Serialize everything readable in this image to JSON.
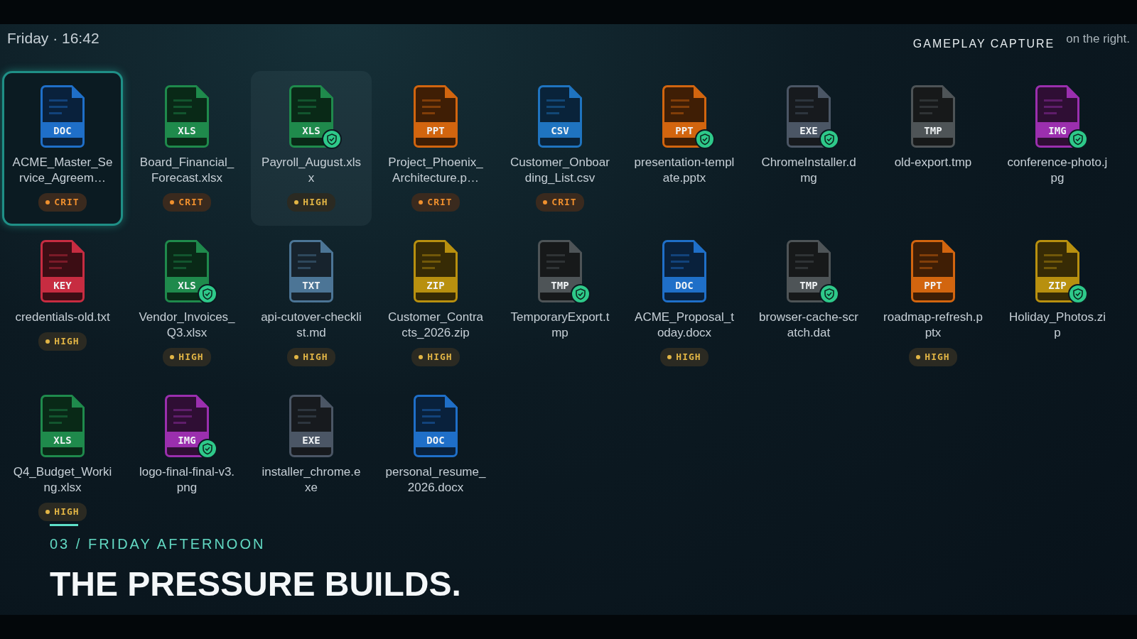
{
  "status": {
    "time": "Friday · 16:42",
    "label": "GAMEPLAY CAPTURE",
    "overlay_text": "on the right."
  },
  "files": [
    {
      "name": "ACME_Master_Service_Agreem…",
      "ext": "DOC",
      "color": "#1f6fc8",
      "shield": false,
      "badge": {
        "kind": "crit",
        "label": "CRIT"
      },
      "selected": true,
      "hovered": false
    },
    {
      "name": "Board_Financial_Forecast.xlsx",
      "ext": "XLS",
      "color": "#1f8a4c",
      "shield": false,
      "badge": {
        "kind": "crit",
        "label": "CRIT"
      },
      "selected": false,
      "hovered": false
    },
    {
      "name": "Payroll_August.xlsx",
      "ext": "XLS",
      "color": "#1f8a4c",
      "shield": true,
      "badge": {
        "kind": "high",
        "label": "HIGH"
      },
      "selected": false,
      "hovered": true
    },
    {
      "name": "Project_Phoenix_Architecture.p…",
      "ext": "PPT",
      "color": "#d2650f",
      "shield": false,
      "badge": {
        "kind": "crit",
        "label": "CRIT"
      },
      "selected": false,
      "hovered": false
    },
    {
      "name": "Customer_Onboarding_List.csv",
      "ext": "CSV",
      "color": "#1f74c0",
      "shield": false,
      "badge": {
        "kind": "crit",
        "label": "CRIT"
      },
      "selected": false,
      "hovered": false
    },
    {
      "name": "presentation-template.pptx",
      "ext": "PPT",
      "color": "#d2650f",
      "shield": true,
      "selected": false,
      "hovered": false
    },
    {
      "name": "ChromeInstaller.dmg",
      "ext": "EXE",
      "color": "#4b5665",
      "shield": true,
      "selected": false,
      "hovered": false
    },
    {
      "name": "old-export.tmp",
      "ext": "TMP",
      "color": "#4e5457",
      "shield": false,
      "selected": false,
      "hovered": false
    },
    {
      "name": "conference-photo.jpg",
      "ext": "IMG",
      "color": "#9b2fae",
      "shield": true,
      "selected": false,
      "hovered": false
    },
    {
      "name": "credentials-old.txt",
      "ext": "KEY",
      "color": "#c72c41",
      "shield": false,
      "badge": {
        "kind": "high",
        "label": "HIGH"
      },
      "selected": false,
      "hovered": false
    },
    {
      "name": "Vendor_Invoices_Q3.xlsx",
      "ext": "XLS",
      "color": "#1f8a4c",
      "shield": true,
      "badge": {
        "kind": "high",
        "label": "HIGH"
      },
      "selected": false,
      "hovered": false
    },
    {
      "name": "api-cutover-checklist.md",
      "ext": "TXT",
      "color": "#4c7596",
      "shield": false,
      "badge": {
        "kind": "high",
        "label": "HIGH"
      },
      "selected": false,
      "hovered": false
    },
    {
      "name": "Customer_Contracts_2026.zip",
      "ext": "ZIP",
      "color": "#b8900f",
      "shield": false,
      "badge": {
        "kind": "high",
        "label": "HIGH"
      },
      "selected": false,
      "hovered": false
    },
    {
      "name": "TemporaryExport.tmp",
      "ext": "TMP",
      "color": "#4e5457",
      "shield": true,
      "selected": false,
      "hovered": false
    },
    {
      "name": "ACME_Proposal_today.docx",
      "ext": "DOC",
      "color": "#1f6fc8",
      "shield": false,
      "badge": {
        "kind": "high",
        "label": "HIGH"
      },
      "selected": false,
      "hovered": false
    },
    {
      "name": "browser-cache-scratch.dat",
      "ext": "TMP",
      "color": "#4e5457",
      "shield": true,
      "selected": false,
      "hovered": false
    },
    {
      "name": "roadmap-refresh.pptx",
      "ext": "PPT",
      "color": "#d2650f",
      "shield": false,
      "badge": {
        "kind": "high",
        "label": "HIGH"
      },
      "selected": false,
      "hovered": false
    },
    {
      "name": "Holiday_Photos.zip",
      "ext": "ZIP",
      "color": "#b8900f",
      "shield": true,
      "selected": false,
      "hovered": false
    },
    {
      "name": "Q4_Budget_Working.xlsx",
      "ext": "XLS",
      "color": "#1f8a4c",
      "shield": false,
      "badge": {
        "kind": "high",
        "label": "HIGH"
      },
      "selected": false,
      "hovered": false
    },
    {
      "name": "logo-final-final-v3.png",
      "ext": "IMG",
      "color": "#9b2fae",
      "shield": true,
      "selected": false,
      "hovered": false
    },
    {
      "name": "installer_chrome.exe",
      "ext": "EXE",
      "color": "#4b5665",
      "shield": false,
      "selected": false,
      "hovered": false
    },
    {
      "name": "personal_resume_2026.docx",
      "ext": "DOC",
      "color": "#1f6fc8",
      "shield": false,
      "selected": false,
      "hovered": false
    }
  ],
  "caption": {
    "chapter": "03 / FRIDAY AFTERNOON",
    "title": "THE PRESSURE BUILDS."
  }
}
